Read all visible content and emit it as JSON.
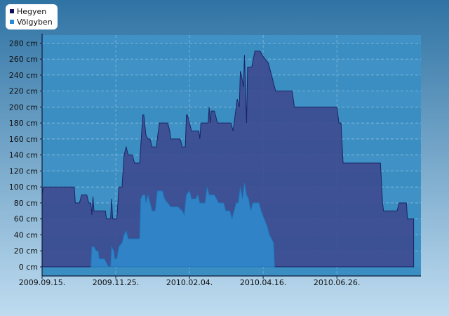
{
  "chart_data": {
    "type": "area",
    "x_type": "date",
    "xlim": [
      "2009-09-15",
      "2010-09-15"
    ],
    "ylim": [
      0,
      290
    ],
    "y_unit": "cm",
    "y_ticks": [
      0,
      20,
      40,
      60,
      80,
      100,
      120,
      140,
      160,
      180,
      200,
      220,
      240,
      260,
      280
    ],
    "y_tick_labels": [
      "0 cm",
      "20 cm",
      "40 cm",
      "60 cm",
      "80 cm",
      "100 cm",
      "120 cm",
      "140 cm",
      "160 cm",
      "180 cm",
      "200 cm",
      "220 cm",
      "240 cm",
      "260 cm",
      "280 cm"
    ],
    "x_ticks": [
      "2009-09-15",
      "2009-11-25",
      "2010-02-04",
      "2010-04-16",
      "2010-06-26"
    ],
    "x_tick_labels": [
      "2009.09.15.",
      "2009.11.25.",
      "2010.02.04.",
      "2010.04.16.",
      "2010.06.26."
    ],
    "grid": true,
    "legend_position": "top-left",
    "colors": {
      "background_top": "#2f73a4",
      "background_bottom": "#bfdcf0",
      "plot_bg": "#3b8ec2",
      "series_1": "#3d4c8f",
      "series_1_marker": "#10105a",
      "series_2": "#2f86c9",
      "series_2_marker": "#2a8ad4"
    },
    "series": [
      {
        "name": "Hegyen",
        "points": [
          [
            "2009-09-15",
            0
          ],
          [
            "2009-09-15",
            90
          ],
          [
            "2009-09-16",
            100
          ],
          [
            "2009-10-16",
            100
          ],
          [
            "2009-10-17",
            80
          ],
          [
            "2009-10-21",
            80
          ],
          [
            "2009-10-23",
            90
          ],
          [
            "2009-10-28",
            90
          ],
          [
            "2009-10-30",
            80
          ],
          [
            "2009-11-01",
            80
          ],
          [
            "2009-11-02",
            65
          ],
          [
            "2009-11-03",
            88
          ],
          [
            "2009-11-04",
            70
          ],
          [
            "2009-11-15",
            70
          ],
          [
            "2009-11-16",
            60
          ],
          [
            "2009-11-20",
            60
          ],
          [
            "2009-11-21",
            85
          ],
          [
            "2009-11-22",
            60
          ],
          [
            "2009-11-26",
            60
          ],
          [
            "2009-11-28",
            100
          ],
          [
            "2009-12-01",
            100
          ],
          [
            "2009-12-03",
            140
          ],
          [
            "2009-12-05",
            150
          ],
          [
            "2009-12-07",
            140
          ],
          [
            "2009-12-11",
            140
          ],
          [
            "2009-12-13",
            130
          ],
          [
            "2009-12-18",
            130
          ],
          [
            "2009-12-20",
            170
          ],
          [
            "2009-12-21",
            190
          ],
          [
            "2009-12-22",
            190
          ],
          [
            "2009-12-24",
            165
          ],
          [
            "2009-12-26",
            160
          ],
          [
            "2009-12-28",
            160
          ],
          [
            "2009-12-30",
            150
          ],
          [
            "2010-01-03",
            150
          ],
          [
            "2010-01-06",
            180
          ],
          [
            "2010-01-14",
            180
          ],
          [
            "2010-01-16",
            170
          ],
          [
            "2010-01-17",
            160
          ],
          [
            "2010-01-26",
            160
          ],
          [
            "2010-01-28",
            150
          ],
          [
            "2010-01-31",
            150
          ],
          [
            "2010-02-01",
            190
          ],
          [
            "2010-02-02",
            190
          ],
          [
            "2010-02-04",
            180
          ],
          [
            "2010-02-06",
            170
          ],
          [
            "2010-02-13",
            170
          ],
          [
            "2010-02-14",
            160
          ],
          [
            "2010-02-15",
            180
          ],
          [
            "2010-02-22",
            180
          ],
          [
            "2010-02-23",
            200
          ],
          [
            "2010-02-24",
            180
          ],
          [
            "2010-02-25",
            195
          ],
          [
            "2010-02-28",
            195
          ],
          [
            "2010-03-02",
            185
          ],
          [
            "2010-03-03",
            180
          ],
          [
            "2010-03-16",
            180
          ],
          [
            "2010-03-18",
            170
          ],
          [
            "2010-03-20",
            190
          ],
          [
            "2010-03-22",
            210
          ],
          [
            "2010-03-23",
            205
          ],
          [
            "2010-03-24",
            200
          ],
          [
            "2010-03-25",
            245
          ],
          [
            "2010-03-26",
            240
          ],
          [
            "2010-03-28",
            225
          ],
          [
            "2010-03-29",
            265
          ],
          [
            "2010-03-31",
            180
          ],
          [
            "2010-04-01",
            250
          ],
          [
            "2010-04-05",
            250
          ],
          [
            "2010-04-08",
            270
          ],
          [
            "2010-04-13",
            270
          ],
          [
            "2010-04-15",
            265
          ],
          [
            "2010-04-18",
            260
          ],
          [
            "2010-04-21",
            255
          ],
          [
            "2010-04-23",
            245
          ],
          [
            "2010-04-25",
            235
          ],
          [
            "2010-04-28",
            220
          ],
          [
            "2010-05-05",
            220
          ],
          [
            "2010-05-14",
            220
          ],
          [
            "2010-05-16",
            200
          ],
          [
            "2010-06-26",
            200
          ],
          [
            "2010-06-28",
            180
          ],
          [
            "2010-06-30",
            180
          ],
          [
            "2010-07-02",
            130
          ],
          [
            "2010-08-07",
            130
          ],
          [
            "2010-08-09",
            80
          ],
          [
            "2010-08-10",
            70
          ],
          [
            "2010-08-23",
            70
          ],
          [
            "2010-08-25",
            80
          ],
          [
            "2010-09-01",
            80
          ],
          [
            "2010-09-02",
            60
          ],
          [
            "2010-09-08",
            60
          ],
          [
            "2010-09-08",
            0
          ]
        ]
      },
      {
        "name": "Völgyben",
        "points": [
          [
            "2009-11-01",
            0
          ],
          [
            "2009-11-02",
            25
          ],
          [
            "2009-11-04",
            25
          ],
          [
            "2009-11-06",
            20
          ],
          [
            "2009-11-08",
            20
          ],
          [
            "2009-11-09",
            10
          ],
          [
            "2009-11-14",
            10
          ],
          [
            "2009-11-16",
            5
          ],
          [
            "2009-11-18",
            0
          ],
          [
            "2009-11-20",
            0
          ],
          [
            "2009-11-21",
            25
          ],
          [
            "2009-11-23",
            20
          ],
          [
            "2009-11-24",
            10
          ],
          [
            "2009-11-26",
            10
          ],
          [
            "2009-11-28",
            25
          ],
          [
            "2009-12-01",
            30
          ],
          [
            "2009-12-03",
            40
          ],
          [
            "2009-12-05",
            45
          ],
          [
            "2009-12-07",
            35
          ],
          [
            "2009-12-18",
            35
          ],
          [
            "2009-12-19",
            85
          ],
          [
            "2009-12-21",
            90
          ],
          [
            "2009-12-23",
            90
          ],
          [
            "2009-12-24",
            80
          ],
          [
            "2009-12-26",
            90
          ],
          [
            "2009-12-28",
            80
          ],
          [
            "2009-12-30",
            70
          ],
          [
            "2010-01-02",
            70
          ],
          [
            "2010-01-04",
            95
          ],
          [
            "2010-01-09",
            95
          ],
          [
            "2010-01-11",
            85
          ],
          [
            "2010-01-14",
            80
          ],
          [
            "2010-01-17",
            75
          ],
          [
            "2010-01-24",
            75
          ],
          [
            "2010-01-28",
            70
          ],
          [
            "2010-01-30",
            65
          ],
          [
            "2010-02-01",
            90
          ],
          [
            "2010-02-04",
            95
          ],
          [
            "2010-02-06",
            85
          ],
          [
            "2010-02-10",
            85
          ],
          [
            "2010-02-12",
            90
          ],
          [
            "2010-02-14",
            80
          ],
          [
            "2010-02-19",
            80
          ],
          [
            "2010-02-21",
            100
          ],
          [
            "2010-02-23",
            90
          ],
          [
            "2010-02-28",
            90
          ],
          [
            "2010-03-02",
            85
          ],
          [
            "2010-03-04",
            80
          ],
          [
            "2010-03-09",
            80
          ],
          [
            "2010-03-11",
            70
          ],
          [
            "2010-03-15",
            70
          ],
          [
            "2010-03-17",
            60
          ],
          [
            "2010-03-19",
            70
          ],
          [
            "2010-03-21",
            80
          ],
          [
            "2010-03-23",
            80
          ],
          [
            "2010-03-25",
            100
          ],
          [
            "2010-03-27",
            85
          ],
          [
            "2010-03-29",
            105
          ],
          [
            "2010-03-31",
            90
          ],
          [
            "2010-04-02",
            85
          ],
          [
            "2010-04-04",
            70
          ],
          [
            "2010-04-06",
            80
          ],
          [
            "2010-04-12",
            80
          ],
          [
            "2010-04-14",
            70
          ],
          [
            "2010-04-17",
            60
          ],
          [
            "2010-04-20",
            50
          ],
          [
            "2010-04-22",
            40
          ],
          [
            "2010-04-24",
            35
          ],
          [
            "2010-04-26",
            30
          ],
          [
            "2010-04-27",
            0
          ]
        ]
      }
    ]
  }
}
